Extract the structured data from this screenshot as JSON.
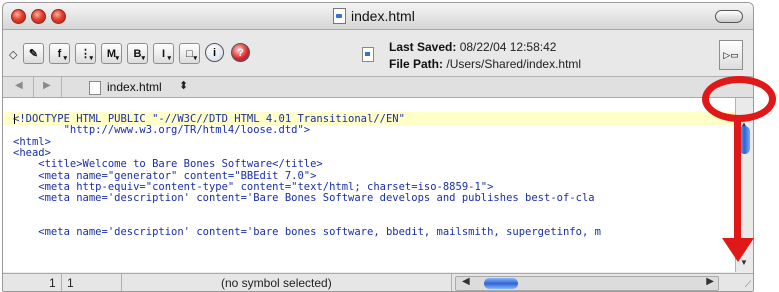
{
  "window": {
    "title": "index.html",
    "colors": {
      "close": "#e2402e",
      "minimize": "#e2402e",
      "zoom": "#e2402e"
    }
  },
  "toolbar": {
    "buttons": [
      {
        "icon": "pencil-icon",
        "glyph": "✎"
      },
      {
        "icon": "function-popup-icon",
        "glyph": "f"
      },
      {
        "icon": "marker-popup-icon",
        "glyph": "⋮"
      },
      {
        "icon": "markup-m-icon",
        "glyph": "M"
      },
      {
        "icon": "document-popup-icon",
        "glyph": "B"
      },
      {
        "icon": "text-cursor-icon",
        "glyph": "I"
      },
      {
        "icon": "window-popup-icon",
        "glyph": "□"
      },
      {
        "icon": "info-icon",
        "glyph": "i"
      },
      {
        "icon": "help-icon",
        "glyph": "?"
      }
    ],
    "last_saved_label": "Last Saved:",
    "last_saved_value": "08/22/04 12:58:42",
    "file_path_label": "File Path:",
    "file_path_value": "/Users/Shared/index.html"
  },
  "navbar": {
    "back": "◀",
    "forward": "▶",
    "file_name": "index.html",
    "updown": "⬍"
  },
  "code": {
    "lines": [
      "<!DOCTYPE HTML PUBLIC \"-//W3C//DTD HTML 4.01 Transitional//EN\"",
      "        \"http://www.w3.org/TR/html4/loose.dtd\">",
      "<html>",
      "<head>",
      "    <title>Welcome to Bare Bones Software</title>",
      "    <meta name=\"generator\" content=\"BBEdit 7.0\">",
      "    <meta http-equiv=\"content-type\" content=\"text/html; charset=iso-8859-1\">",
      "    <meta name='description' content='Bare Bones Software develops and publishes best-of-cla",
      "",
      "    <meta name='description' content='bare bones software, bbedit, mailsmith, supergetinfo, m"
    ]
  },
  "status": {
    "line": "1",
    "column": "1",
    "symbol": "(no symbol selected)"
  },
  "annotation": {
    "color": "#e01818"
  }
}
